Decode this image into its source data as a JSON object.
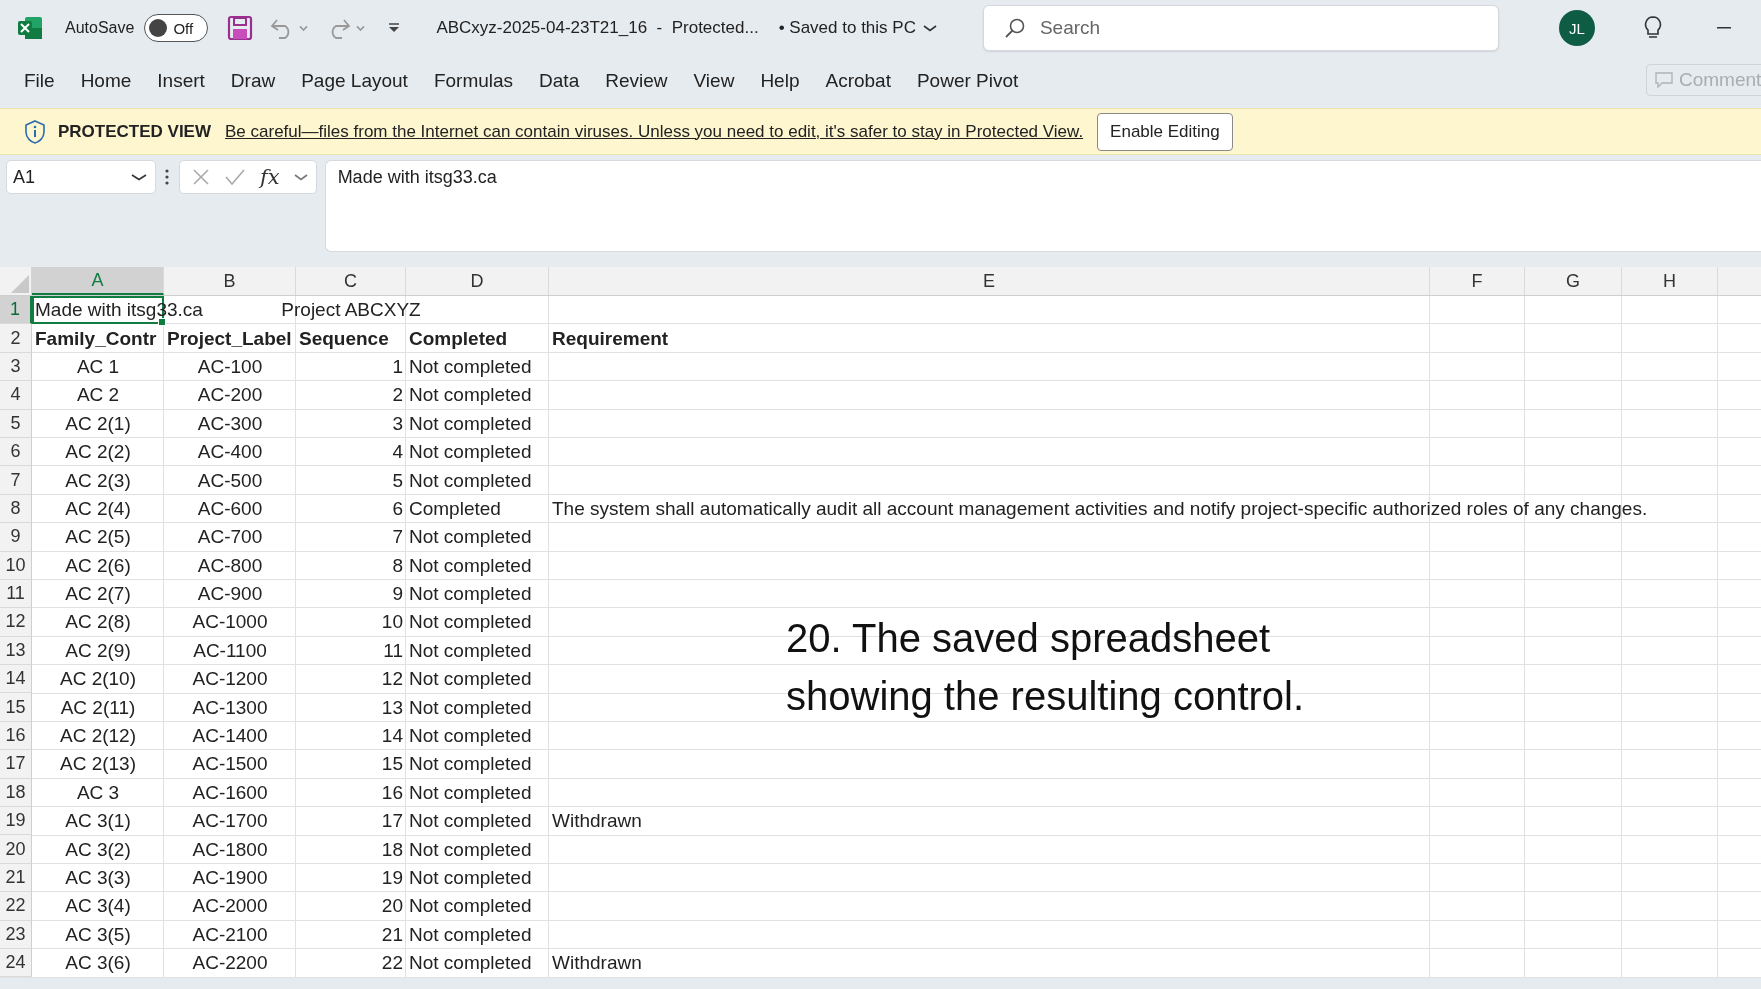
{
  "title_bar": {
    "autosave_label": "AutoSave",
    "autosave": {
      "on": false,
      "label": "Off"
    },
    "file_name": "ABCxyz-2025-04-23T21_16  -  Protected...",
    "save_status": "• Saved to this PC",
    "search_placeholder": "Search",
    "avatar": "JL"
  },
  "ribbon_tabs": [
    "File",
    "Home",
    "Insert",
    "Draw",
    "Page Layout",
    "Formulas",
    "Data",
    "Review",
    "View",
    "Help",
    "Acrobat",
    "Power Pivot"
  ],
  "comment_button": {
    "label": "Comment",
    "disabled": true
  },
  "protected_view": {
    "title": "PROTECTED VIEW",
    "message": "Be careful—files from the Internet can contain viruses. Unless you need to edit, it's safer to stay in Protected View.",
    "button": "Enable Editing"
  },
  "formula_bar": {
    "name_box": "A1",
    "function_label": "fx",
    "formula": "Made with itsg33.ca"
  },
  "sheet": {
    "columns": [
      {
        "label": "A",
        "selected": true
      },
      {
        "label": "B",
        "selected": false
      },
      {
        "label": "C",
        "selected": false
      },
      {
        "label": "D",
        "selected": false
      },
      {
        "label": "E",
        "selected": false
      },
      {
        "label": "F",
        "selected": false
      },
      {
        "label": "G",
        "selected": false
      },
      {
        "label": "H",
        "selected": false
      }
    ],
    "rows": [
      {
        "number": "1",
        "selected": true,
        "kind": "title",
        "cells": [
          "Made with itsg33.ca",
          "",
          "Project ABCXYZ",
          "",
          ""
        ]
      },
      {
        "number": "2",
        "selected": false,
        "kind": "header",
        "cells": [
          "Family_Contr",
          "Project_Label",
          "Sequence",
          "Completed",
          "Requirement"
        ]
      },
      {
        "number": "3",
        "selected": false,
        "kind": "plain",
        "cells": [
          "AC 1",
          "AC-100",
          "1",
          "Not completed",
          ""
        ]
      },
      {
        "number": "4",
        "selected": false,
        "kind": "plain",
        "cells": [
          "AC 2",
          "AC-200",
          "2",
          "Not completed",
          ""
        ]
      },
      {
        "number": "5",
        "selected": false,
        "kind": "plain",
        "cells": [
          "AC 2(1)",
          "AC-300",
          "3",
          "Not completed",
          ""
        ]
      },
      {
        "number": "6",
        "selected": false,
        "kind": "plain",
        "cells": [
          "AC 2(2)",
          "AC-400",
          "4",
          "Not completed",
          ""
        ]
      },
      {
        "number": "7",
        "selected": false,
        "kind": "plain",
        "cells": [
          "AC 2(3)",
          "AC-500",
          "5",
          "Not completed",
          ""
        ]
      },
      {
        "number": "8",
        "selected": false,
        "kind": "plain",
        "cells": [
          "AC 2(4)",
          "AC-600",
          "6",
          "Completed",
          "The system shall automatically audit all account management activities and notify project-specific authorized roles of any changes."
        ]
      },
      {
        "number": "9",
        "selected": false,
        "kind": "plain",
        "cells": [
          "AC 2(5)",
          "AC-700",
          "7",
          "Not completed",
          ""
        ]
      },
      {
        "number": "10",
        "selected": false,
        "kind": "plain",
        "cells": [
          "AC 2(6)",
          "AC-800",
          "8",
          "Not completed",
          ""
        ]
      },
      {
        "number": "11",
        "selected": false,
        "kind": "plain",
        "cells": [
          "AC 2(7)",
          "AC-900",
          "9",
          "Not completed",
          ""
        ]
      },
      {
        "number": "12",
        "selected": false,
        "kind": "plain",
        "cells": [
          "AC 2(8)",
          "AC-1000",
          "10",
          "Not completed",
          ""
        ]
      },
      {
        "number": "13",
        "selected": false,
        "kind": "plain",
        "cells": [
          "AC 2(9)",
          "AC-1100",
          "11",
          "Not completed",
          ""
        ]
      },
      {
        "number": "14",
        "selected": false,
        "kind": "plain",
        "cells": [
          "AC 2(10)",
          "AC-1200",
          "12",
          "Not completed",
          ""
        ]
      },
      {
        "number": "15",
        "selected": false,
        "kind": "plain",
        "cells": [
          "AC 2(11)",
          "AC-1300",
          "13",
          "Not completed",
          ""
        ]
      },
      {
        "number": "16",
        "selected": false,
        "kind": "plain",
        "cells": [
          "AC 2(12)",
          "AC-1400",
          "14",
          "Not completed",
          ""
        ]
      },
      {
        "number": "17",
        "selected": false,
        "kind": "plain",
        "cells": [
          "AC 2(13)",
          "AC-1500",
          "15",
          "Not completed",
          ""
        ]
      },
      {
        "number": "18",
        "selected": false,
        "kind": "plain",
        "cells": [
          "AC 3",
          "AC-1600",
          "16",
          "Not completed",
          ""
        ]
      },
      {
        "number": "19",
        "selected": false,
        "kind": "plain",
        "cells": [
          "AC 3(1)",
          "AC-1700",
          "17",
          "Not completed",
          "Withdrawn"
        ]
      },
      {
        "number": "20",
        "selected": false,
        "kind": "plain",
        "cells": [
          "AC 3(2)",
          "AC-1800",
          "18",
          "Not completed",
          ""
        ]
      },
      {
        "number": "21",
        "selected": false,
        "kind": "plain",
        "cells": [
          "AC 3(3)",
          "AC-1900",
          "19",
          "Not completed",
          ""
        ]
      },
      {
        "number": "22",
        "selected": false,
        "kind": "plain",
        "cells": [
          "AC 3(4)",
          "AC-2000",
          "20",
          "Not completed",
          ""
        ]
      },
      {
        "number": "23",
        "selected": false,
        "kind": "plain",
        "cells": [
          "AC 3(5)",
          "AC-2100",
          "21",
          "Not completed",
          ""
        ]
      },
      {
        "number": "24",
        "selected": false,
        "kind": "plain",
        "cells": [
          "AC 3(6)",
          "AC-2200",
          "22",
          "Not completed",
          "Withdrawn"
        ]
      }
    ]
  },
  "caption": "20. The saved spreadsheet showing the resulting control."
}
